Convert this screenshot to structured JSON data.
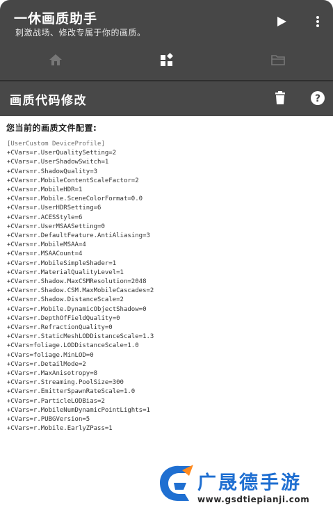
{
  "app": {
    "title": "一休画质助手",
    "subtitle": "刺激战场、修改专属于你的画质。"
  },
  "toolbar": {
    "play_icon": "play-icon",
    "more_icon": "more-vertical-icon"
  },
  "tabs": [
    {
      "icon": "home-icon",
      "selected": false
    },
    {
      "icon": "widgets-icon",
      "selected": true
    },
    {
      "icon": "folder-icon",
      "selected": false
    }
  ],
  "subheader": {
    "title": "画质代码修改",
    "delete_icon": "trash-icon",
    "help_icon": "help-icon"
  },
  "content": {
    "label": "您当前的画质文件配置:",
    "config_lines": [
      "[UserCustom DeviceProfile]",
      "+CVars=r.UserQualitySetting=2",
      "+CVars=r.UserShadowSwitch=1",
      "+CVars=r.ShadowQuality=3",
      "+CVars=r.MobileContentScaleFactor=2",
      "+CVars=r.MobileHDR=1",
      "+CVars=r.Mobile.SceneColorFormat=0.0",
      "+CVars=r.UserHDRSetting=6",
      "+CVars=r.ACESStyle=6",
      "+CVars=r.UserMSAASetting=0",
      "+CVars=r.DefaultFeature.AntiAliasing=3",
      "+CVars=r.MobileMSAA=4",
      "+CVars=r.MSAACount=4",
      "+CVars=r.MobileSimpleShader=1",
      "+CVars=r.MaterialQualityLevel=1",
      "+CVars=r.Shadow.MaxCSMResolution=2048",
      "+CVars=r.Shadow.CSM.MaxMobileCascades=2",
      "+CVars=r.Shadow.DistanceScale=2",
      "+CVars=r.Mobile.DynamicObjectShadow=0",
      "+CVars=r.DepthOfFieldQuality=0",
      "+CVars=r.RefractionQuality=0",
      "+CVars=r.StaticMeshLODDistanceScale=1.3",
      "+CVars=foliage.LODDistanceScale=1.0",
      "+CVars=foliage.MinLOD=0",
      "+CVars=r.DetailMode=2",
      "+CVars=r.MaxAnisotropy=8",
      "+CVars=r.Streaming.PoolSize=300",
      "+CVars=r.EmitterSpawnRateScale=1.0",
      "+CVars=r.ParticleLODBias=2",
      "+CVars=r.MobileNumDynamicPointLights=1",
      "+CVars=r.PUBGVersion=5",
      "+CVars=r.Mobile.EarlyZPass=1"
    ]
  },
  "watermark": {
    "name": "广晟德手游",
    "url": "www.gsdtiepianji.com"
  },
  "colors": {
    "appbar": "#474747",
    "subheader": "#484848",
    "watermark_blue": "#1f6fd1"
  }
}
